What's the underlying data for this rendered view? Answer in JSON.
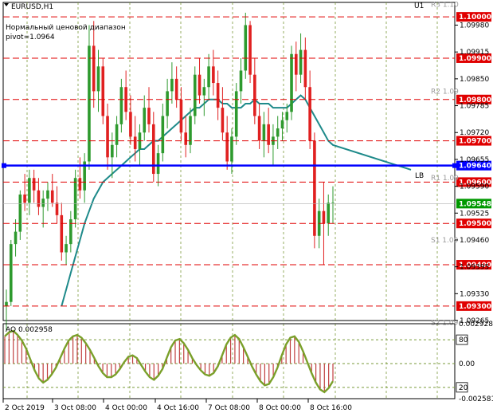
{
  "window": {
    "title": "EURUSD,H1",
    "note_line1": "Нормальный ценовой диапазон",
    "note_line2": "pivot=1.0964",
    "u1_label": "U1",
    "lb_label": "LB"
  },
  "chart_data": {
    "type": "candlestick",
    "symbol": "EURUSD",
    "timeframe": "H1",
    "ylim": [
      1.09265,
      1.10035
    ],
    "time_labels": [
      "2 Oct 2019",
      "3 Oct 08:00",
      "4 Oct 00:00",
      "4 Oct 16:00",
      "7 Oct 08:00",
      "8 Oct 00:00",
      "8 Oct 16:00"
    ],
    "price_ticks": [
      "1.09980",
      "1.09915",
      "1.09850",
      "1.09785",
      "1.09720",
      "1.09655",
      "1.09590",
      "1.09525",
      "1.09460",
      "1.09395",
      "1.09330",
      "1.09265"
    ],
    "levels": [
      {
        "label": "1.10000",
        "value": 1.1,
        "color": "#e00000"
      },
      {
        "label": "1.09900",
        "value": 1.099,
        "color": "#e00000"
      },
      {
        "label": "1.09800",
        "value": 1.098,
        "color": "#e00000"
      },
      {
        "label": "1.09700",
        "value": 1.097,
        "color": "#e00000"
      },
      {
        "label": "1.09640",
        "value": 1.0964,
        "color": "#0000ff"
      },
      {
        "label": "1.09600",
        "value": 1.096,
        "color": "#e00000"
      },
      {
        "label": "1.09548",
        "value": 1.09548,
        "color": "#009900"
      },
      {
        "label": "1.09500",
        "value": 1.095,
        "color": "#e00000"
      },
      {
        "label": "1.09400",
        "value": 1.094,
        "color": "#e00000"
      },
      {
        "label": "1.09300",
        "value": 1.093,
        "color": "#e00000"
      }
    ],
    "pivot_labels": [
      {
        "name": "R3 1.10",
        "value": 1.1003
      },
      {
        "name": "R2 1.09",
        "value": 1.0982
      },
      {
        "name": "R1 1.09",
        "value": 1.0961
      },
      {
        "name": "S1 1.09",
        "value": 1.0946
      },
      {
        "name": "S2 1.09",
        "value": 1.0926
      }
    ],
    "candles": [
      [
        1.093,
        1.0934,
        1.0924,
        1.0931
      ],
      [
        1.0931,
        1.0946,
        1.093,
        1.0945
      ],
      [
        1.0945,
        1.0951,
        1.0942,
        1.0948
      ],
      [
        1.0948,
        1.0958,
        1.0946,
        1.0957
      ],
      [
        1.0957,
        1.0962,
        1.0953,
        1.0955
      ],
      [
        1.0955,
        1.0963,
        1.0952,
        1.0961
      ],
      [
        1.0961,
        1.0963,
        1.0955,
        1.0958
      ],
      [
        1.0958,
        1.0961,
        1.0952,
        1.0954
      ],
      [
        1.0954,
        1.0958,
        1.0949,
        1.0956
      ],
      [
        1.0956,
        1.096,
        1.0953,
        1.0958
      ],
      [
        1.0958,
        1.0962,
        1.0954,
        1.0955
      ],
      [
        1.0955,
        1.0959,
        1.095,
        1.0952
      ],
      [
        1.0952,
        1.0955,
        1.0941,
        1.0943
      ],
      [
        1.0943,
        1.0947,
        1.094,
        1.0945
      ],
      [
        1.0945,
        1.0953,
        1.0943,
        1.0951
      ],
      [
        1.0951,
        1.0963,
        1.0949,
        1.0961
      ],
      [
        1.0961,
        1.0966,
        1.0956,
        1.0958
      ],
      [
        1.0958,
        1.0967,
        1.0955,
        1.0965
      ],
      [
        1.0965,
        1.0998,
        1.0963,
        1.0993
      ],
      [
        1.0993,
        1.0999,
        1.0978,
        1.0982
      ],
      [
        1.0982,
        1.0992,
        1.0977,
        1.0988
      ],
      [
        1.0988,
        1.099,
        1.0974,
        1.0976
      ],
      [
        1.0976,
        1.0979,
        1.0963,
        1.0966
      ],
      [
        1.0966,
        1.0972,
        1.0961,
        1.0969
      ],
      [
        1.0969,
        1.0976,
        1.0966,
        1.0974
      ],
      [
        1.0974,
        1.0985,
        1.0972,
        1.0983
      ],
      [
        1.0983,
        1.0987,
        1.0975,
        1.0977
      ],
      [
        1.0977,
        1.0981,
        1.0969,
        1.0971
      ],
      [
        1.0971,
        1.0976,
        1.0965,
        1.0968
      ],
      [
        1.0968,
        1.0974,
        1.0964,
        1.0972
      ],
      [
        1.0972,
        1.0981,
        1.097,
        1.0978
      ],
      [
        1.0978,
        1.0983,
        1.0972,
        1.0974
      ],
      [
        1.0974,
        1.0977,
        1.096,
        1.0962
      ],
      [
        1.0962,
        1.0969,
        1.0959,
        1.0967
      ],
      [
        1.0967,
        1.0979,
        1.0965,
        1.0976
      ],
      [
        1.0976,
        1.0985,
        1.0973,
        1.0982
      ],
      [
        1.0982,
        1.0989,
        1.0979,
        1.0985
      ],
      [
        1.0985,
        1.0988,
        1.0978,
        1.098
      ],
      [
        1.098,
        1.0983,
        1.097,
        1.0972
      ],
      [
        1.0972,
        1.0976,
        1.0966,
        1.0969
      ],
      [
        1.0969,
        1.0978,
        1.0967,
        1.0976
      ],
      [
        1.0976,
        1.0988,
        1.0974,
        1.0986
      ],
      [
        1.0986,
        1.099,
        1.0979,
        1.0981
      ],
      [
        1.0981,
        1.0985,
        1.0976,
        1.0983
      ],
      [
        1.0983,
        1.0991,
        1.098,
        1.0988
      ],
      [
        1.0988,
        1.0992,
        1.0981,
        1.0984
      ],
      [
        1.0984,
        1.0987,
        1.0975,
        1.0978
      ],
      [
        1.0978,
        1.0983,
        1.097,
        1.0972
      ],
      [
        1.0972,
        1.0976,
        1.0963,
        1.0965
      ],
      [
        1.0965,
        1.0973,
        1.0962,
        1.0971
      ],
      [
        1.0971,
        1.0984,
        1.0969,
        1.0982
      ],
      [
        1.0982,
        1.099,
        1.0979,
        1.0987
      ],
      [
        1.0987,
        1.1001,
        1.0985,
        1.0998
      ],
      [
        1.0998,
        1.0999,
        1.0984,
        1.0986
      ],
      [
        1.0986,
        1.099,
        1.0974,
        1.0976
      ],
      [
        1.0976,
        1.0979,
        1.0968,
        1.097
      ],
      [
        1.097,
        1.0977,
        1.0966,
        1.0974
      ],
      [
        1.0974,
        1.0978,
        1.0967,
        1.0969
      ],
      [
        1.0969,
        1.0974,
        1.0964,
        1.0971
      ],
      [
        1.0971,
        1.0976,
        1.0968,
        1.0973
      ],
      [
        1.0973,
        1.0977,
        1.097,
        1.0975
      ],
      [
        1.0975,
        1.0979,
        1.0972,
        1.0977
      ],
      [
        1.0977,
        1.0993,
        1.0975,
        1.0991
      ],
      [
        1.0991,
        1.0994,
        1.0982,
        1.0986
      ],
      [
        1.0986,
        1.0996,
        1.0984,
        1.0992
      ],
      [
        1.0992,
        1.0995,
        1.098,
        1.0983
      ],
      [
        1.0983,
        1.0987,
        1.0968,
        1.097
      ],
      [
        1.097,
        1.0972,
        1.0944,
        1.0947
      ],
      [
        1.0947,
        1.0956,
        1.0944,
        1.0953
      ],
      [
        1.0953,
        1.096,
        1.094,
        1.095
      ],
      [
        1.095,
        1.0957,
        1.0947,
        1.0955
      ],
      [
        1.0955,
        1.0959,
        1.095,
        1.0955
      ]
    ],
    "ma_values": [
      null,
      null,
      null,
      null,
      null,
      null,
      null,
      null,
      null,
      null,
      null,
      null,
      1.093,
      1.0934,
      1.0938,
      1.0942,
      1.0946,
      1.095,
      1.0953,
      1.0956,
      1.0958,
      1.096,
      1.0961,
      1.0962,
      1.0963,
      1.0964,
      1.0965,
      1.0966,
      1.0967,
      1.0968,
      1.0968,
      1.0969,
      1.097,
      1.097,
      1.0971,
      1.0972,
      1.0973,
      1.0974,
      1.0975,
      1.0976,
      1.0977,
      1.0978,
      1.0978,
      1.0979,
      1.098,
      1.098,
      1.098,
      1.0979,
      1.0979,
      1.0978,
      1.0978,
      1.0978,
      1.0979,
      1.0979,
      1.098,
      1.0979,
      1.0979,
      1.0979,
      1.0978,
      1.0978,
      1.0978,
      1.0978,
      1.0979,
      1.098,
      1.0981,
      1.098,
      1.0978,
      1.0976,
      1.0974,
      1.0972,
      1.097,
      1.0969
    ],
    "ma_extension": [
      [
        1.0969,
        1.0963
      ]
    ],
    "oscillator": {
      "label": "AO 0.002958",
      "ylim": [
        -0.002581,
        0.002928
      ],
      "ticks": [
        "0.002928",
        "80",
        "0.00",
        "20",
        "-0.002581"
      ],
      "level_80": 0.00175,
      "level_20": -0.00175,
      "values": [
        0.002,
        0.0023,
        0.0024,
        0.0021,
        0.0017,
        0.0011,
        0.0003,
        -0.0005,
        -0.0011,
        -0.0014,
        -0.0012,
        -0.0008,
        -0.0003,
        0.0004,
        0.0011,
        0.0017,
        0.002,
        0.0021,
        0.0019,
        0.0015,
        0.001,
        0.0004,
        -0.0002,
        -0.0007,
        -0.001,
        -0.001,
        -0.0008,
        -0.0004,
        0.0001,
        0.0005,
        0.0006,
        0.0004,
        -0.0001,
        -0.0006,
        -0.001,
        -0.0012,
        -0.0009,
        -0.0004,
        0.0004,
        0.0012,
        0.0017,
        0.0018,
        0.0015,
        0.001,
        0.0004,
        -0.0001,
        -0.0005,
        -0.0008,
        -0.0009,
        -0.0007,
        -0.0002,
        0.0006,
        0.0014,
        0.0019,
        0.0021,
        0.0018,
        0.0012,
        0.0005,
        -0.0002,
        -0.0008,
        -0.0013,
        -0.0016,
        -0.0015,
        -0.001,
        -0.0003,
        0.0006,
        0.0014,
        0.0019,
        0.002,
        0.0016,
        0.0009,
        0.0001,
        -0.0007,
        -0.0014,
        -0.0019,
        -0.0021,
        -0.0018,
        -0.0013
      ]
    }
  }
}
